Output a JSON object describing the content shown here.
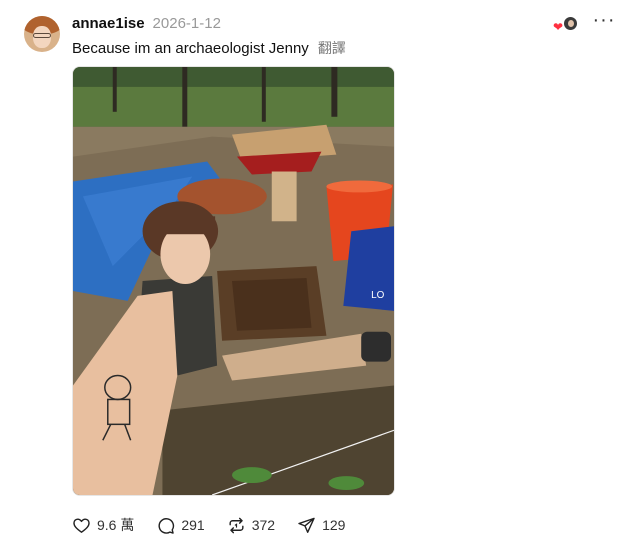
{
  "post": {
    "username": "annae1ise",
    "timestamp": "2026-1-12",
    "caption": "Because im an archaeologist Jenny",
    "translate_label": "翻譯",
    "more_label": "···",
    "reaction_heart": "❤"
  },
  "actions": {
    "likes": "9.6 萬",
    "comments": "291",
    "reposts": "372",
    "shares": "129"
  },
  "icons": {
    "like": "heart-icon",
    "comment": "comment-bubble-icon",
    "repost": "repost-icon",
    "share": "share-send-icon",
    "more": "more-options-icon"
  },
  "colors": {
    "reaction_heart": "#ff3040",
    "timestamp": "#999999",
    "text": "#101010"
  }
}
